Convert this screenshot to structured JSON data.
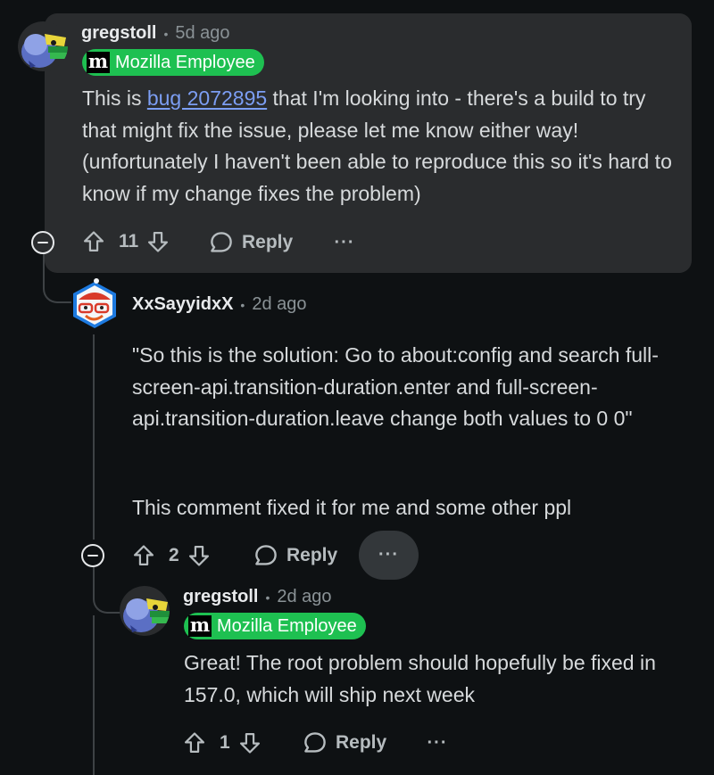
{
  "comments": [
    {
      "username": "gregstoll",
      "time": "5d ago",
      "flair": {
        "logo": "m",
        "label": "Mozilla Employee",
        "color": "#1ec051"
      },
      "body_before_link": "This is ",
      "link_text": "bug 2072895",
      "body_after_link": " that I'm looking into - there's a build to try that might fix the issue, please let me know either way! (unfortunately I haven't been able to reproduce this so it's hard to know if my change fixes the problem)",
      "votes": "11",
      "reply_label": "Reply",
      "more_label": "···",
      "highlighted": true
    },
    {
      "username": "XxSayyidxX",
      "time": "2d ago",
      "body_paragraph_1": "\"So this is the solution: Go to about:config and search full-screen-api.transition-duration.enter and full-screen-api.transition-duration.leave change both values to 0 0\"",
      "body_paragraph_2": "This comment fixed it for me and some other ppl",
      "votes": "2",
      "reply_label": "Reply",
      "more_label": "···"
    },
    {
      "username": "gregstoll",
      "time": "2d ago",
      "flair": {
        "logo": "m",
        "label": "Mozilla Employee",
        "color": "#1ec051"
      },
      "body": "Great! The root problem should hopefully be fixed in 157.0, which will ship next week",
      "votes": "1",
      "reply_label": "Reply",
      "more_label": "···"
    }
  ],
  "separator": "•",
  "icons": [
    "collapse-minus-icon",
    "upvote-arrow-icon",
    "downvote-arrow-icon",
    "reply-bubble-icon",
    "more-dots-icon"
  ],
  "colors": {
    "background": "#0e1113",
    "highlight_card": "#2a2c2e",
    "link": "#7c9ef3",
    "flair": "#1ec051",
    "muted": "#8a9296"
  }
}
